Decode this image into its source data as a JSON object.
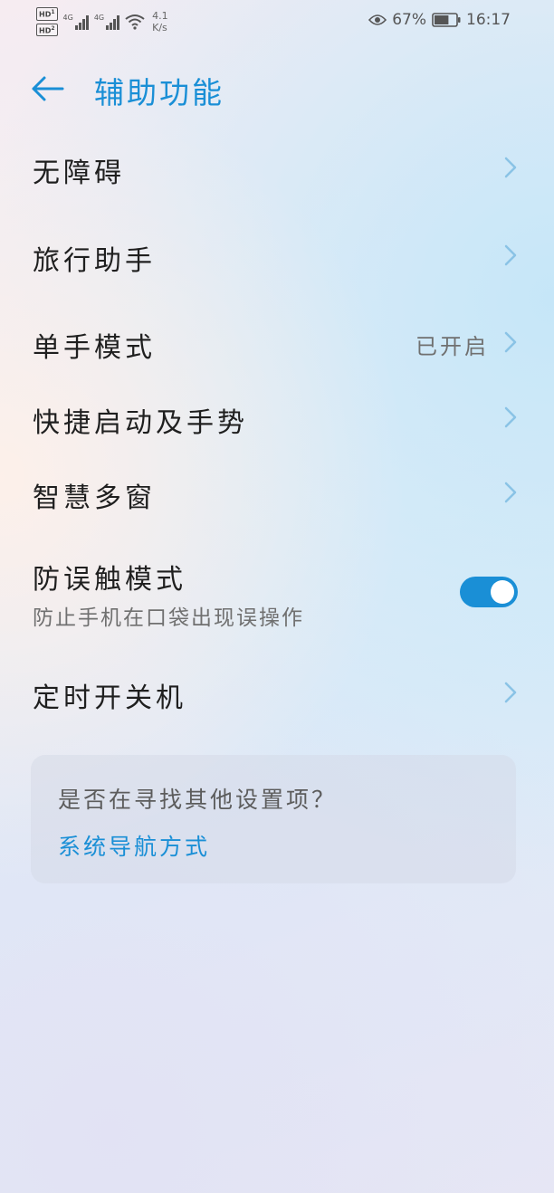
{
  "status_bar": {
    "sim1_badge": "HD",
    "sim1_index": "1",
    "sim2_badge": "HD",
    "sim2_index": "2",
    "net1": "4G",
    "net2": "4G",
    "speed_value": "4.1",
    "speed_unit": "K/s",
    "battery_percent": "67%",
    "battery_level": 0.67,
    "time": "16:17",
    "icons": [
      "signal-icon",
      "wifi-icon",
      "eye-icon",
      "battery-icon"
    ]
  },
  "header": {
    "back_icon": "back-arrow-icon",
    "title": "辅助功能"
  },
  "settings": {
    "accessibility": {
      "title": "无障碍"
    },
    "travel_assistant": {
      "title": "旅行助手"
    },
    "one_hand_mode": {
      "title": "单手模式",
      "value": "已开启"
    },
    "quick_launch": {
      "title": "快捷启动及手势"
    },
    "smart_multiwindow": {
      "title": "智慧多窗"
    },
    "pocket_mode": {
      "title": "防误触模式",
      "subtitle": "防止手机在口袋出现误操作",
      "enabled": true
    },
    "scheduled_power": {
      "title": "定时开关机"
    }
  },
  "card": {
    "title": "是否在寻找其他设置项？",
    "link": "系统导航方式"
  },
  "colors": {
    "accent": "#1a8fd6",
    "chevron": "#8ac3e6",
    "primary_text": "#1f1f1f",
    "secondary_text": "#707070"
  }
}
